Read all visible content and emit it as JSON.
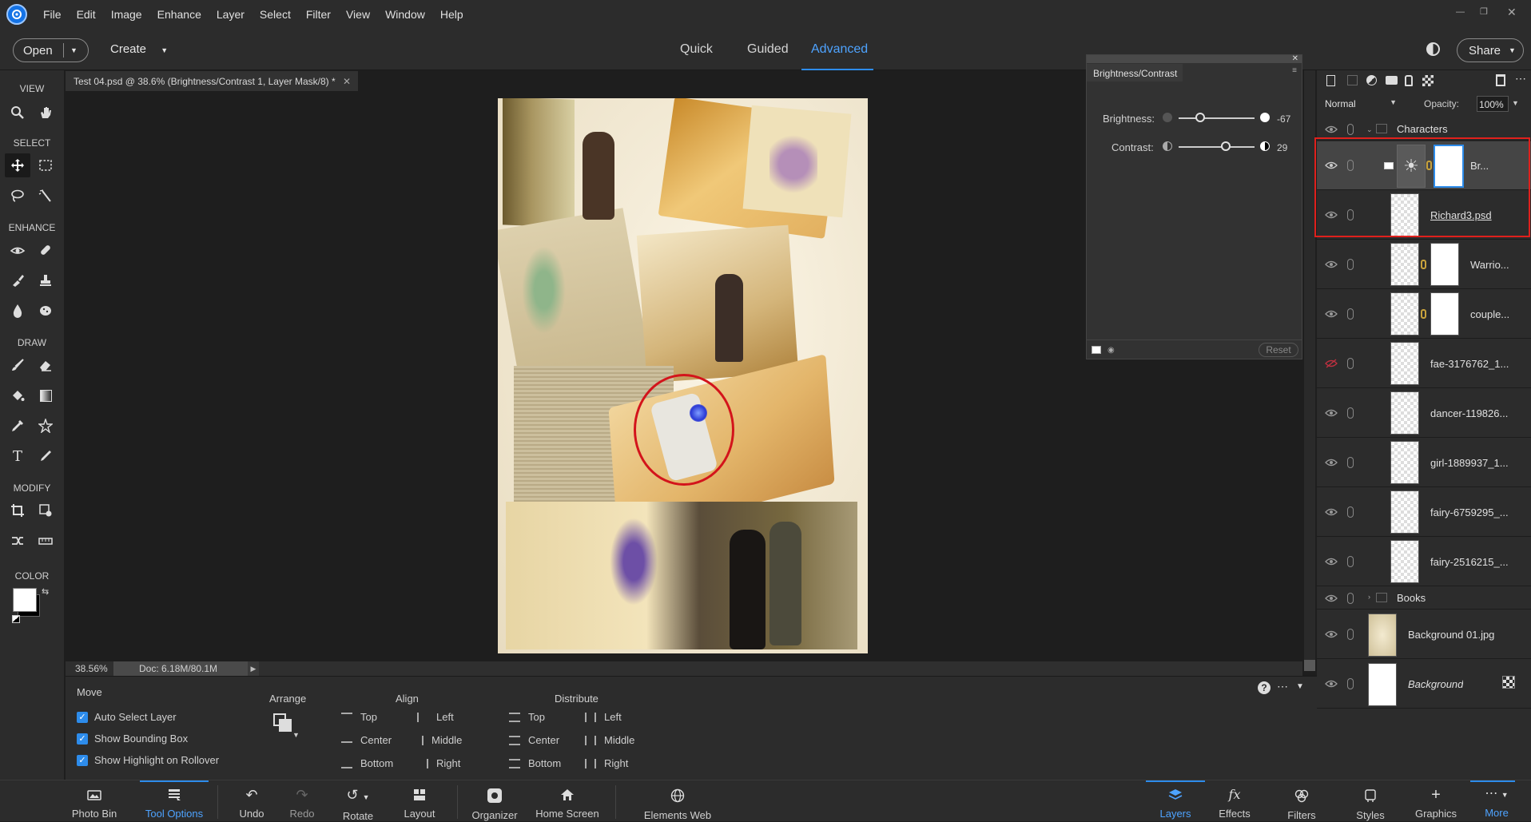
{
  "menubar": {
    "items": [
      "File",
      "Edit",
      "Image",
      "Enhance",
      "Layer",
      "Select",
      "Filter",
      "View",
      "Window",
      "Help"
    ]
  },
  "topbar": {
    "open_label": "Open",
    "create_label": "Create",
    "mode_tabs": [
      "Quick",
      "Guided",
      "Advanced"
    ],
    "active_mode": "Advanced",
    "share_label": "Share"
  },
  "toolbar": {
    "sections": [
      "VIEW",
      "SELECT",
      "ENHANCE",
      "DRAW",
      "MODIFY",
      "COLOR"
    ],
    "tools": [
      "zoom-icon",
      "hand-icon",
      "move-icon",
      "marquee-icon",
      "lasso-icon",
      "quick-select-icon",
      "red-eye-icon",
      "spot-heal-icon",
      "smart-brush-icon",
      "clone-stamp-icon",
      "blur-icon",
      "sponge-icon",
      "brush-icon",
      "eraser-icon",
      "paint-bucket-icon",
      "gradient-icon",
      "eyedropper-icon",
      "custom-shape-icon",
      "type-icon",
      "pencil-icon",
      "crop-icon",
      "recompose-icon",
      "content-move-icon",
      "straighten-icon"
    ]
  },
  "document": {
    "tab_title": "Test 04.psd @ 38.6% (Brightness/Contrast 1, Layer Mask/8) *",
    "zoom": "38.56%",
    "doc_size": "Doc: 6.18M/80.1M"
  },
  "brightness_panel": {
    "title": "Brightness/Contrast",
    "brightness_label": "Brightness:",
    "brightness_value": "-67",
    "brightness_fraction": 0.28,
    "contrast_label": "Contrast:",
    "contrast_value": "29",
    "contrast_fraction": 0.62,
    "reset_label": "Reset"
  },
  "options": {
    "tool_name": "Move",
    "checkboxes": [
      "Auto Select Layer",
      "Show Bounding Box",
      "Show Highlight on Rollover"
    ],
    "arrange_label": "Arrange",
    "align_label": "Align",
    "align_col1": [
      "Top",
      "Center",
      "Bottom"
    ],
    "align_col2": [
      "Left",
      "Middle",
      "Right"
    ],
    "distribute_label": "Distribute",
    "dist_col1": [
      "Top",
      "Center",
      "Bottom"
    ],
    "dist_col2": [
      "Left",
      "Middle",
      "Right"
    ]
  },
  "bottombar": {
    "left": [
      "Photo Bin",
      "Tool Options",
      "Undo",
      "Redo",
      "Rotate",
      "Layout",
      "Organizer",
      "Home Screen",
      "Elements Web"
    ],
    "active_left": "Tool Options",
    "right": [
      "Layers",
      "Effects",
      "Filters",
      "Styles",
      "Graphics",
      "More"
    ],
    "active_right": "Layers"
  },
  "layers": {
    "blend_mode": "Normal",
    "opacity_label": "Opacity:",
    "opacity_value": "100%",
    "group_characters": "Characters",
    "group_books": "Books",
    "rows": [
      "Br...",
      "Richard3.psd",
      "Warrio...",
      "couple...",
      "fae-3176762_1...",
      "dancer-119826...",
      "girl-1889937_1...",
      "fairy-6759295_...",
      "fairy-2516215_..."
    ],
    "background_rows": [
      "Background 01.jpg",
      "Background"
    ]
  },
  "colors": {
    "accent": "#2d8ceb",
    "highlight_box": "#e0201c"
  }
}
